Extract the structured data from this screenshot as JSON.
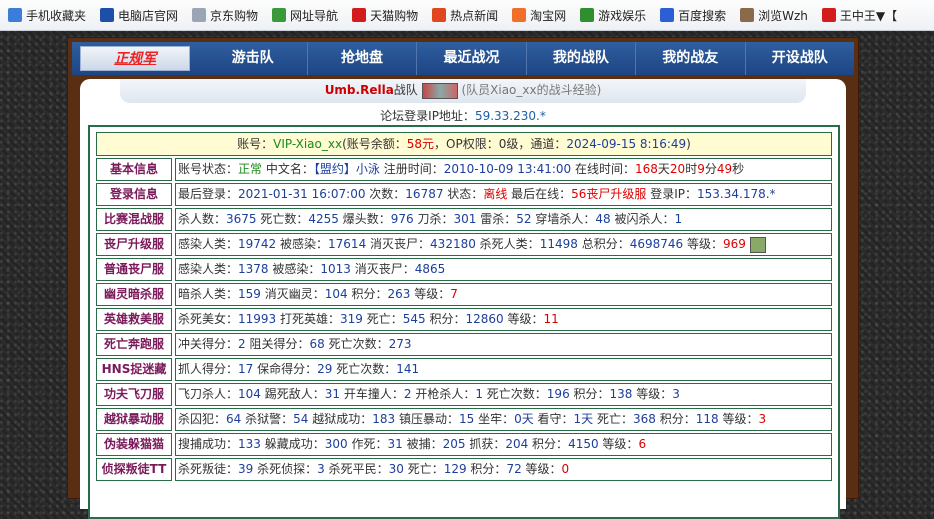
{
  "bookmarks": [
    {
      "label": "手机收藏夹",
      "icon": "bookmark-icon",
      "color": "#3b7dd8"
    },
    {
      "label": "电脑店官网",
      "icon": "pc-store-icon",
      "color": "#1d4fa8"
    },
    {
      "label": "京东购物",
      "icon": "page-icon",
      "color": "#9aa6b5"
    },
    {
      "label": "网址导航",
      "icon": "site-nav-icon",
      "color": "#3a9a3a"
    },
    {
      "label": "天猫购物",
      "icon": "tmall-icon",
      "color": "#d21c1c"
    },
    {
      "label": "热点新闻",
      "icon": "weibo-icon",
      "color": "#e0471f"
    },
    {
      "label": "淘宝网",
      "icon": "taobao-icon",
      "color": "#f0702a"
    },
    {
      "label": "游戏娱乐",
      "icon": "game-icon",
      "color": "#2f8f2f"
    },
    {
      "label": "百度搜索",
      "icon": "baidu-icon",
      "color": "#2b5fd6"
    },
    {
      "label": "浏览Wzh",
      "icon": "avatar-icon",
      "color": "#8a6a4a"
    },
    {
      "label": "王中王▼【",
      "icon": "opera-icon",
      "color": "#d31c1c"
    }
  ],
  "nav": [
    "正规军",
    "游击队",
    "抢地盘",
    "最近战况",
    "我的战队",
    "我的战友",
    "开设战队"
  ],
  "header": {
    "team": "Umb.Rella",
    "team_suffix": "战队",
    "member_note": "(队员Xiao_xx的战斗经验)"
  },
  "ip": {
    "label": "论坛登录IP地址：",
    "value": "59.33.230.*"
  },
  "account": {
    "p1": "账号：",
    "id": "VIP-Xiao_xx",
    "p2": "(账号余额：",
    "balance": "58元",
    "p3": "，OP权限：0级，通道：",
    "time": "2024-09-15 8:16:49",
    ")": ")"
  },
  "rows": [
    {
      "label": "基本信息"
    },
    {
      "label": "登录信息"
    },
    {
      "label": "比赛混战服"
    },
    {
      "label": "丧尸升级服"
    },
    {
      "label": "普通丧尸服"
    },
    {
      "label": "幽灵暗杀服"
    },
    {
      "label": "英雄救美服"
    },
    {
      "label": "死亡奔跑服"
    },
    {
      "label": "HNS捉迷藏"
    },
    {
      "label": "功夫飞刀服"
    },
    {
      "label": "越狱暴动服"
    },
    {
      "label": "伪装躲猫猫"
    },
    {
      "label": "侦探叛徒TT"
    }
  ],
  "basic": {
    "a": "账号状态：",
    "status": "正常",
    "b": " 中文名：",
    "cn": "【盟约】小泳",
    "c": " 注册时间：",
    "reg": "2010-10-09 13:41:00",
    "d": " 在线时间：",
    "days": "168",
    "e": "天",
    "hours": "20",
    "f": "时",
    "mins": "9",
    "g": "分",
    "secs": "49",
    "h": "秒"
  },
  "login": {
    "a": "最后登录：",
    "last": "2021-01-31 16:07:00",
    "b": " 次数：",
    "count": "16787",
    "c": " 状态：",
    "state": "离线",
    "d": " 最后在线：",
    "server": "56丧尸升级服",
    "e": " 登录IP：",
    "ip": "153.34.178.*"
  },
  "r_mix": {
    "a": "杀人数：",
    "k": "3675",
    "b": " 死亡数：",
    "d": "4255",
    "c": " 爆头数：",
    "hs": "976",
    "e": " 刀杀：",
    "knife": "301",
    "f": " 雷杀：",
    "nade": "52",
    "g": " 穿墙杀人：",
    "wall": "48",
    "h": " 被闪杀人：",
    "flash": "1"
  },
  "r_zup": {
    "a": "感染人类：",
    "inf": "19742",
    "b": " 被感染：",
    "binf": "17614",
    "c": " 消灭丧尸：",
    "kz": "432180",
    "d": " 杀死人类：",
    "kh": "11498",
    "e": " 总积分：",
    "score": "4698746",
    "f": " 等级：",
    "lvl": "969"
  },
  "r_zn": {
    "a": "感染人类：",
    "inf": "1378",
    "b": " 被感染：",
    "binf": "1013",
    "c": " 消灭丧尸：",
    "kz": "4865"
  },
  "r_ghost": {
    "a": "暗杀人类：",
    "k": "159",
    "b": " 消灭幽灵：",
    "kg": "104",
    "c": " 积分：",
    "score": "263",
    "d": " 等级：",
    "lvl": "7"
  },
  "r_hero": {
    "a": "杀死美女：",
    "k": "11993",
    "b": " 打死英雄：",
    "kh": "319",
    "c": " 死亡：",
    "d": "545",
    "e": " 积分：",
    "score": "12860",
    "f": " 等级：",
    "lvl": "11"
  },
  "r_run": {
    "a": "冲关得分：",
    "s": "2",
    "b": " 阻关得分：",
    "block": "68",
    "c": " 死亡次数：",
    "d": "273"
  },
  "r_hns": {
    "a": "抓人得分：",
    "s": "17",
    "b": " 保命得分：",
    "save": "29",
    "c": " 死亡次数：",
    "d": "141"
  },
  "r_kf": {
    "a": "飞刀杀人：",
    "k": "104",
    "b": " 踢死敌人：",
    "kick": "31",
    "c": " 开车撞人：",
    "car": "2",
    "d": " 开枪杀人：",
    "gun": "1",
    "e": " 死亡次数：",
    "dd": "196",
    "f": " 积分：",
    "score": "138",
    "g": " 等级：",
    "lvl": "3"
  },
  "r_jail": {
    "a": "杀囚犯：",
    "k": "64",
    "b": " 杀狱警：",
    "kg": "54",
    "c": " 越狱成功：",
    "esc": "183",
    "d": " 镇压暴动：",
    "riot": "15",
    "e": " 坐牢：",
    "jail": "0天",
    "f": " 看守：",
    "guard": "1天",
    "g": " 死亡：",
    "dd": "368",
    "h": " 积分：",
    "score": "118",
    "i": " 等级：",
    "lvl": "3"
  },
  "r_prop": {
    "a": "搜捕成功：",
    "s": "133",
    "b": " 躲藏成功：",
    "hide": "300",
    "c": " 作死：",
    "die": "31",
    "d": " 被捕：",
    "caught": "205",
    "e": " 抓获：",
    "got": "204",
    "f": " 积分：",
    "score": "4150",
    "g": " 等级：",
    "lvl": "6"
  },
  "r_tt": {
    "a": "杀死叛徒：",
    "k": "39",
    "b": " 杀死侦探：",
    "kd": "3",
    "c": " 杀死平民：",
    "kc": "30",
    "d": " 死亡：",
    "dd": "129",
    "e": " 积分：",
    "score": "72",
    "f": " 等级：",
    "lvl": "0"
  }
}
